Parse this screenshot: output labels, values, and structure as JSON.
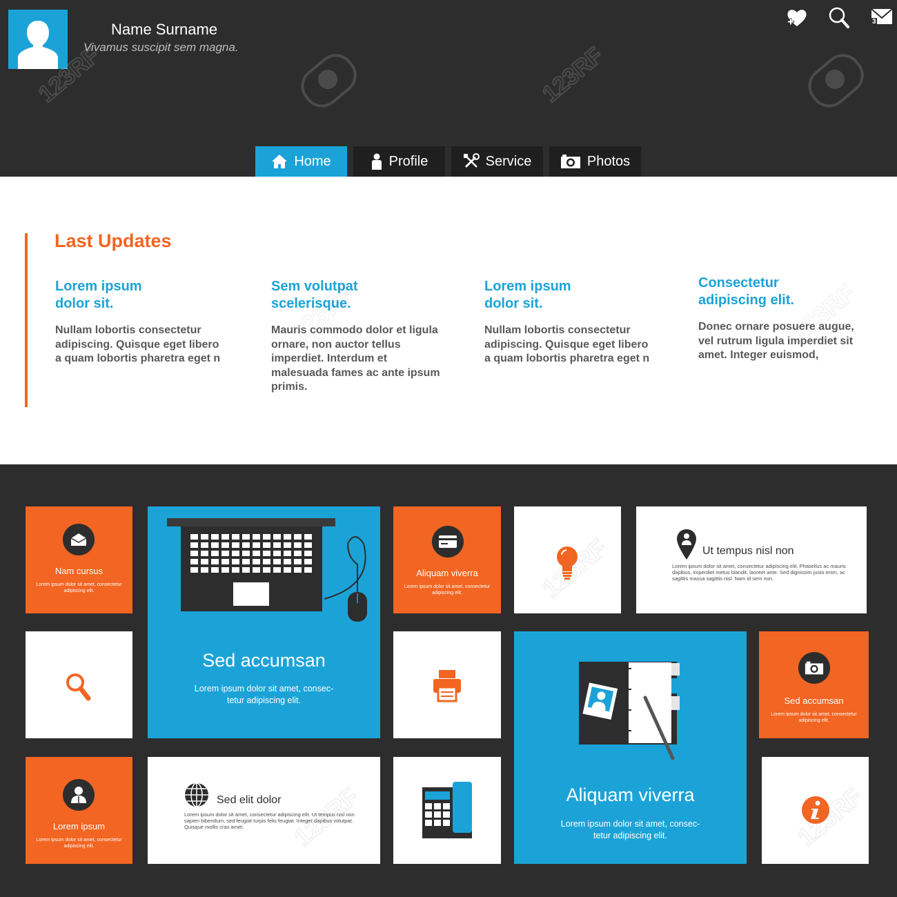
{
  "profile": {
    "name": "Name Surname",
    "tagline": "Vivamus suscipit sem magna."
  },
  "top_icons": {
    "favorites_icon": "heart-plus-icon",
    "search_icon": "search-icon",
    "mail_icon": "mail-icon",
    "mail_count": "3"
  },
  "nav": {
    "items": [
      {
        "label": "Home",
        "icon": "home-icon",
        "active": true
      },
      {
        "label": "Profile",
        "icon": "person-icon",
        "active": false
      },
      {
        "label": "Service",
        "icon": "tools-icon",
        "active": false
      },
      {
        "label": "Photos",
        "icon": "camera-icon",
        "active": false
      }
    ]
  },
  "updates": {
    "title": "Last Updates",
    "columns": [
      {
        "title": "Lorem ipsum\ndolor sit.",
        "text": "Nullam lobortis consectetur adipiscing. Quisque eget libero a quam lobortis pharetra eget n"
      },
      {
        "title": "Sem volutpat\nscelerisque.",
        "text": "Mauris commodo dolor et ligula ornare, non auctor tellus imperdiet. Interdum et malesuada fames ac ante ipsum primis."
      },
      {
        "title": "Lorem ipsum\ndolor sit.",
        "text": "Nullam lobortis consectetur adipiscing. Quisque eget libero a quam lobortis pharetra eget n"
      },
      {
        "title": "Consectetur\nadipiscing elit.",
        "text": "Donec ornare posuere augue, vel rutrum ligula imperdiet sit amet. Integer euismod,"
      }
    ]
  },
  "tiles": {
    "nam_cursus": {
      "label": "Nam cursus",
      "text": "Lorem ipsum dolor sit amet, consectetur adipiscing elit.",
      "icon": "envelope-icon"
    },
    "laptop": {
      "title": "Sed accumsan",
      "text": "Lorem ipsum dolor sit amet, consec-\ntetur adipiscing elit.",
      "icon": "laptop-icon"
    },
    "aliquam_small": {
      "label": "Aliquam viverra",
      "text": "Lorem ipsum dolor sit amet, consectetur adipiscing elit.",
      "icon": "credit-card-icon"
    },
    "bulb": {
      "icon": "lightbulb-icon"
    },
    "ut_tempus": {
      "title": "Ut tempus nisl non",
      "text": "Lorem ipsum dolor sit amet, consectetur adipiscing elit. Phasellus ac mauris dapibus, imperdiet metus blandit, laoreet ante. Sed dignissim justo enim, ac sagittis massa sagittis nisl. Nam id sem non.",
      "icon": "map-pin-icon"
    },
    "search": {
      "icon": "search-icon"
    },
    "printer": {
      "icon": "printer-icon"
    },
    "notebook": {
      "title": "Aliquam viverra",
      "text": "Lorem ipsum dolor sit amet, consec-\ntetur adipiscing elit.",
      "icon": "notebook-icon"
    },
    "camera_tile": {
      "label": "Sed accumsan",
      "text": "Lorem ipsum dolor sit amet, consectetur adipiscing elit.",
      "icon": "camera-icon"
    },
    "lorem_tile": {
      "label": "Lorem ipsum",
      "text": "Lorem ipsum dolor sit amet, consectetur adipiscing elit.",
      "icon": "user-icon"
    },
    "sed_elit": {
      "title": "Sed elit dolor",
      "text": "Lorem ipsum dolor sit amet, consectetur adipiscing elit. Ut tempus nisl non sapien bibendum, sed feugiat turpis felis feugiat. Integer dapibus volutpat. Quisque mollis cras amet.",
      "icon": "globe-icon"
    },
    "phone": {
      "icon": "phone-icon"
    },
    "info": {
      "icon": "info-icon"
    }
  },
  "watermark": "123RF",
  "colors": {
    "dark": "#2d2d2d",
    "blue": "#1ba3d8",
    "orange": "#f26522",
    "white": "#ffffff"
  }
}
